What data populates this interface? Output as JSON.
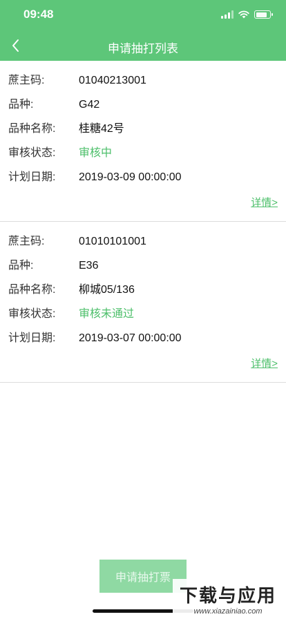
{
  "status_bar": {
    "time": "09:48"
  },
  "nav": {
    "title": "申请抽打列表"
  },
  "records": [
    {
      "fields": [
        {
          "label": "蔗主码:",
          "value": "01040213001",
          "highlight": false
        },
        {
          "label": "品种:",
          "value": "G42",
          "highlight": false
        },
        {
          "label": "品种名称:",
          "value": "桂糖42号",
          "highlight": false
        },
        {
          "label": "审核状态:",
          "value": "审核中",
          "highlight": true
        },
        {
          "label": "计划日期:",
          "value": "2019-03-09 00:00:00",
          "highlight": false
        }
      ],
      "detail_label": "详情>"
    },
    {
      "fields": [
        {
          "label": "蔗主码:",
          "value": "01010101001",
          "highlight": false
        },
        {
          "label": "品种:",
          "value": "E36",
          "highlight": false
        },
        {
          "label": "品种名称:",
          "value": "柳城05/136",
          "highlight": false
        },
        {
          "label": "审核状态:",
          "value": "审核未通过",
          "highlight": true
        },
        {
          "label": "计划日期:",
          "value": "2019-03-07 00:00:00",
          "highlight": false
        }
      ],
      "detail_label": "详情>"
    }
  ],
  "footer": {
    "apply_label": "申请抽打票"
  },
  "watermark": {
    "main": "下载与应用",
    "url": "www.xiazainiao.com"
  },
  "colors": {
    "primary": "#5dc679",
    "status_green": "#4cbf6a",
    "button_disabled": "#8fd9a3"
  }
}
